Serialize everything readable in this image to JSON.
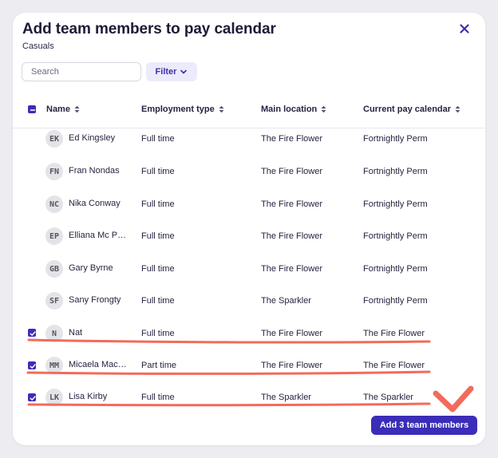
{
  "dialog": {
    "title": "Add team members to pay calendar",
    "subtitle": "Casuals",
    "close_icon": "close-icon"
  },
  "search": {
    "placeholder": "Search",
    "value": ""
  },
  "filter": {
    "label": "Filter",
    "icon": "chevron-down-icon"
  },
  "table": {
    "select_all_checked": true,
    "columns": [
      "Name",
      "Employment type",
      "Main location",
      "Current pay calendar"
    ],
    "rows": [
      {
        "initials": "EK",
        "name": "Ed Kingsley",
        "employment": "Full time",
        "location": "The Fire Flower",
        "calendar": "Fortnightly Perm",
        "checked": false
      },
      {
        "initials": "FN",
        "name": "Fran Nondas",
        "employment": "Full time",
        "location": "The Fire Flower",
        "calendar": "Fortnightly Perm",
        "checked": false
      },
      {
        "initials": "NC",
        "name": "Nika Conway",
        "employment": "Full time",
        "location": "The Fire Flower",
        "calendar": "Fortnightly Perm",
        "checked": false
      },
      {
        "initials": "EP",
        "name": "Elliana Mc Ph...",
        "employment": "Full time",
        "location": "The Fire Flower",
        "calendar": "Fortnightly Perm",
        "checked": false
      },
      {
        "initials": "GB",
        "name": "Gary Byrne",
        "employment": "Full time",
        "location": "The Fire Flower",
        "calendar": "Fortnightly Perm",
        "checked": false
      },
      {
        "initials": "SF",
        "name": "Sany Frongty",
        "employment": "Full time",
        "location": "The Sparkler",
        "calendar": "Fortnightly Perm",
        "checked": false
      },
      {
        "initials": "N",
        "name": "Nat",
        "employment": "Full time",
        "location": "The Fire Flower",
        "calendar": "The Fire Flower",
        "checked": true
      },
      {
        "initials": "MM",
        "name": "Micaela MacL...",
        "employment": "Part time",
        "location": "The Fire Flower",
        "calendar": "The Fire Flower",
        "checked": true
      },
      {
        "initials": "LK",
        "name": "Lisa Kirby",
        "employment": "Full time",
        "location": "The Sparkler",
        "calendar": "The Sparkler",
        "checked": true
      }
    ]
  },
  "footer": {
    "add_button_label": "Add 3 team members"
  },
  "colors": {
    "accent": "#3b2db8",
    "filter_bg": "#ecebfb",
    "annotation": "#f26b5b",
    "background": "#ececf1"
  }
}
